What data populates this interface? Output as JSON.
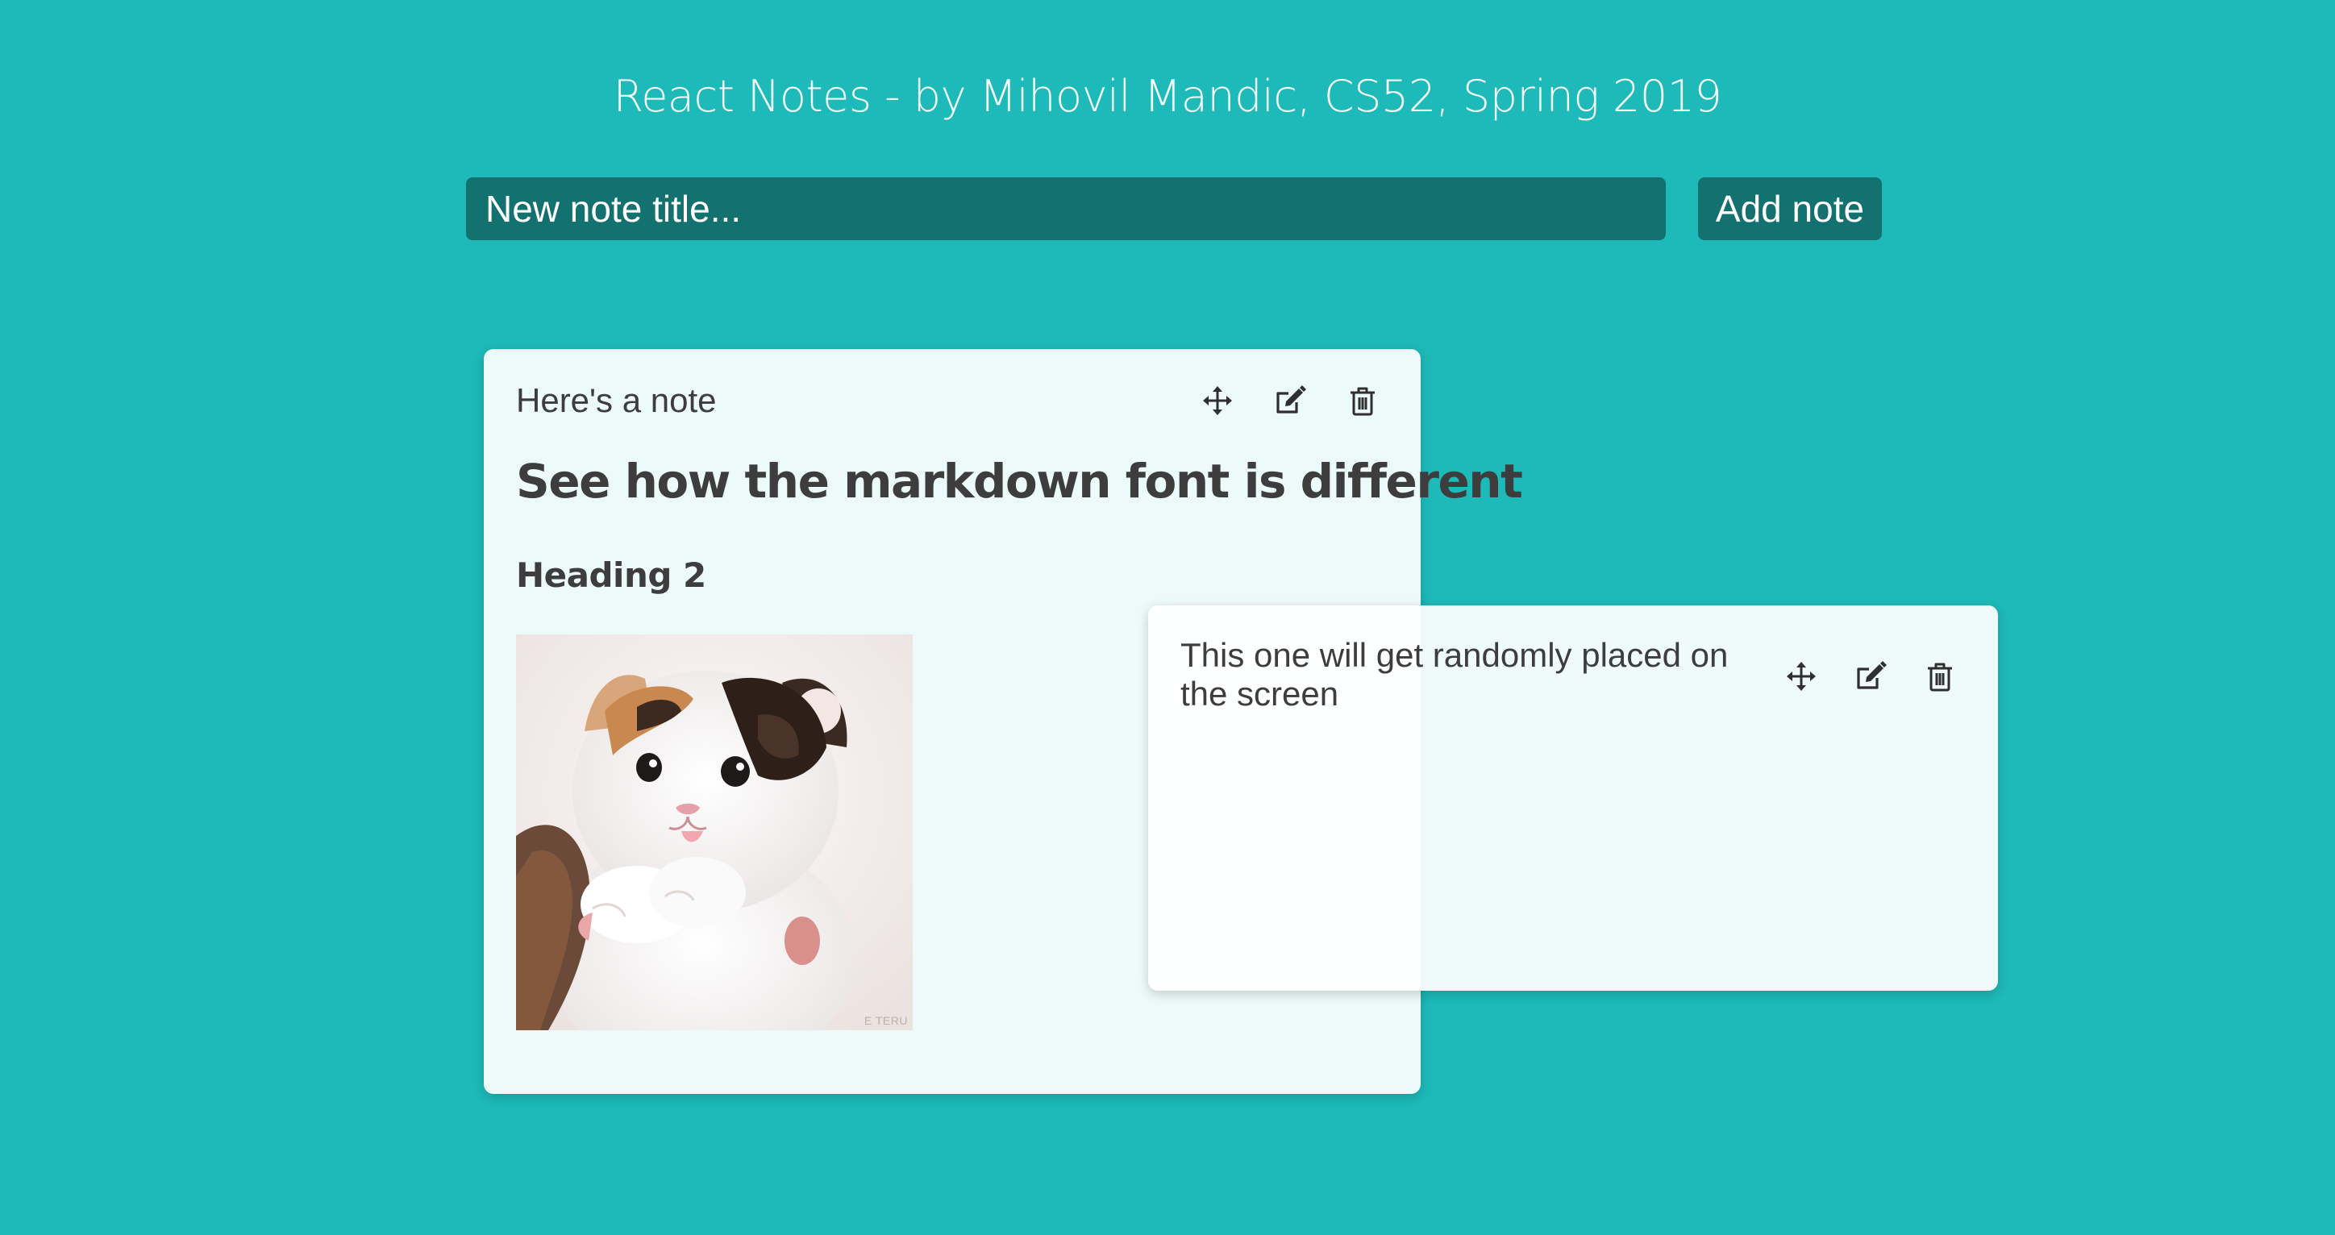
{
  "header": {
    "title": "React Notes - by Mihovil Mandic, CS52, Spring 2019"
  },
  "new_note": {
    "placeholder": "New note title...",
    "add_label": "Add note"
  },
  "notes": [
    {
      "title": "Here's a note",
      "content": {
        "h1": "See how the markdown font is different",
        "h2": "Heading 2",
        "image": {
          "alt": "kitten",
          "watermark": "E TERU"
        }
      },
      "icons": [
        "move-icon",
        "edit-icon",
        "trash-icon"
      ]
    },
    {
      "title": "This one will get randomly placed on the screen",
      "icons": [
        "move-icon",
        "edit-icon",
        "trash-icon"
      ]
    }
  ],
  "colors": {
    "background": "#1eb9b9",
    "input_bg": "#137170",
    "note_bg": "#eef8f8",
    "text": "#3d3d3d"
  }
}
